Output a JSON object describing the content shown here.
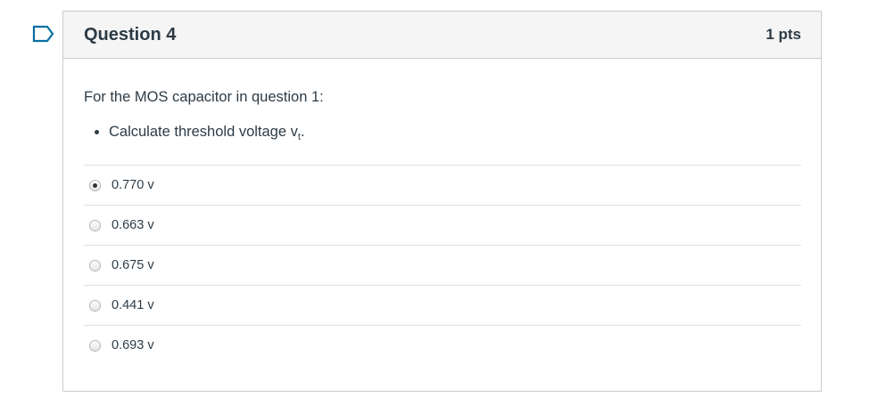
{
  "question": {
    "title": "Question 4",
    "points": "1 pts",
    "prompt": "For the MOS capacitor in question 1:",
    "bullet_text": "Calculate threshold voltage v",
    "bullet_subscript": "t",
    "bullet_suffix": ".",
    "selected_index": 0,
    "answers": [
      {
        "label": "0.770 v",
        "selected": true
      },
      {
        "label": "0.663 v",
        "selected": false
      },
      {
        "label": "0.675 v",
        "selected": false
      },
      {
        "label": "0.441 v",
        "selected": false
      },
      {
        "label": "0.693 v",
        "selected": false
      }
    ]
  },
  "colors": {
    "flag": "#0770a3",
    "header_bg": "#f5f5f5",
    "border": "#c7cdd1",
    "text": "#2d3b45"
  },
  "icons": {
    "flag": "flag-question-icon"
  }
}
